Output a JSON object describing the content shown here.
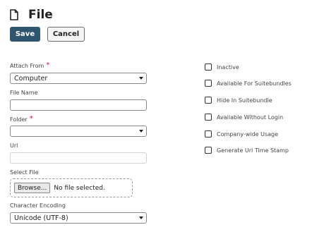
{
  "header": {
    "title": "File",
    "icon": "document-icon"
  },
  "toolbar": {
    "save_label": "Save",
    "cancel_label": "Cancel",
    "save_color": "#30566f"
  },
  "form": {
    "attach_from": {
      "label": "Attach From",
      "required_marker": "*",
      "value": "Computer"
    },
    "file_name": {
      "label": "File Name",
      "value": ""
    },
    "folder": {
      "label": "Folder",
      "required_marker": "*",
      "value": ""
    },
    "url": {
      "label": "Url",
      "value": ""
    },
    "select_file": {
      "label": "Select File",
      "browse_label": "Browse...",
      "status": "No file selected."
    },
    "character_encoding": {
      "label": "Character Encoding",
      "value": "Unicode (UTF-8)"
    }
  },
  "checkboxes": [
    {
      "label": "Inactive",
      "checked": false
    },
    {
      "label": "Available For Suitebundles",
      "checked": false
    },
    {
      "label": "Hide In Suitebundle",
      "checked": false
    },
    {
      "label": "Available Without Login",
      "checked": false
    },
    {
      "label": "Company-wide Usage",
      "checked": false
    },
    {
      "label": "Generate Url Time Stamp",
      "checked": false
    }
  ]
}
